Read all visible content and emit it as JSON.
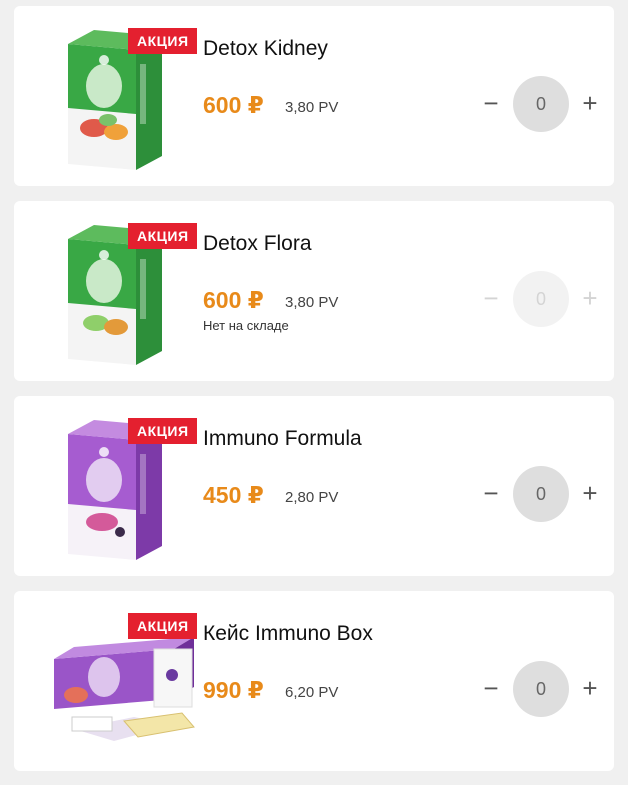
{
  "products": [
    {
      "badge": "АКЦИЯ",
      "name": "Detox Kidney",
      "price": "600 ₽",
      "pv": "3,80 PV",
      "stock_note": "",
      "quantity": "0",
      "minus": "−",
      "plus": "+",
      "image_icon": "detox-kidney-box-image",
      "box_color": "#2ea043"
    },
    {
      "badge": "АКЦИЯ",
      "name": "Detox Flora",
      "price": "600 ₽",
      "pv": "3,80 PV",
      "stock_note": "Нет на складе",
      "quantity": "0",
      "minus": "−",
      "plus": "+",
      "image_icon": "detox-flora-box-image",
      "box_color": "#2ea043"
    },
    {
      "badge": "АКЦИЯ",
      "name": "Immuno Formula",
      "price": "450 ₽",
      "pv": "2,80 PV",
      "stock_note": "",
      "quantity": "0",
      "minus": "−",
      "plus": "+",
      "image_icon": "immuno-formula-box-image",
      "box_color": "#9a4fc8"
    },
    {
      "badge": "АКЦИЯ",
      "name": "Кейс Immuno Box",
      "price": "990 ₽",
      "pv": "6,20 PV",
      "stock_note": "",
      "quantity": "0",
      "minus": "−",
      "plus": "+",
      "image_icon": "immuno-box-case-image",
      "box_color": "#8a4bc0"
    }
  ],
  "colors": {
    "price": "#e88a1a",
    "badge": "#e4202f",
    "qty_circle": "#dedede",
    "background": "#f0f0f0"
  }
}
